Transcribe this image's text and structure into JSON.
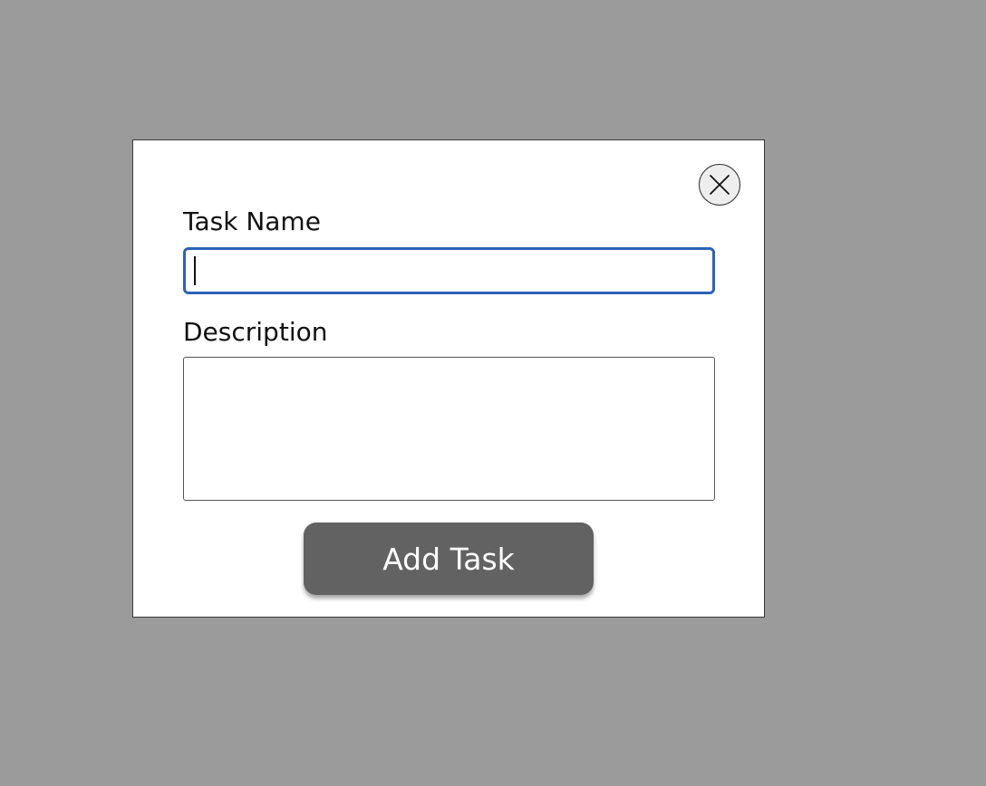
{
  "colors": {
    "backdrop": "#9b9b9b",
    "modal_background": "#ffffff",
    "input_focus_border": "#2a63b8",
    "button_background": "#626262",
    "button_text": "#ffffff",
    "close_button_background": "#eeeeee"
  },
  "modal": {
    "close_icon": "close-x-icon",
    "task_name": {
      "label": "Task Name",
      "value": ""
    },
    "description": {
      "label": "Description",
      "value": ""
    },
    "submit_label": "Add Task"
  }
}
